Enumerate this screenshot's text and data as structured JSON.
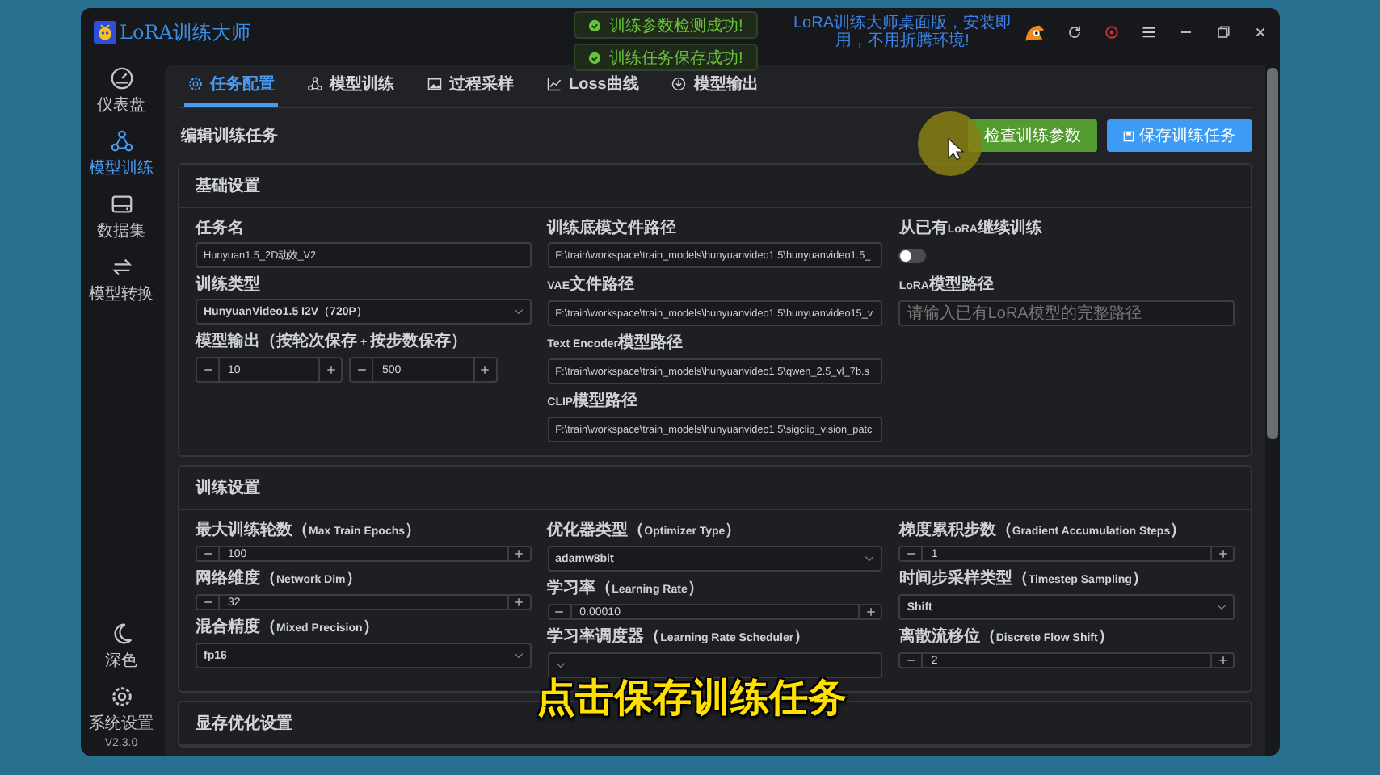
{
  "window": {
    "app_name": "LoRA训练大师",
    "promo": [
      "LoRA训练大师桌面版，安装即",
      "用，不用折腾环境!"
    ]
  },
  "toasts": [
    {
      "text": "训练参数检测成功!"
    },
    {
      "text": "训练任务保存成功!"
    }
  ],
  "sidebar": {
    "items": [
      {
        "label": "仪表盘",
        "selected": false
      },
      {
        "label": "模型训练",
        "selected": true
      },
      {
        "label": "数据集",
        "selected": false
      },
      {
        "label": "模型转换",
        "selected": false
      }
    ],
    "bottom": [
      {
        "label": "深色"
      },
      {
        "label": "系统设置"
      }
    ],
    "version": "V2.3.0"
  },
  "tabs": [
    {
      "label": "任务配置",
      "selected": true
    },
    {
      "label": "模型训练",
      "selected": false
    },
    {
      "label": "过程采样",
      "selected": false
    },
    {
      "label": "Loss曲线",
      "selected": false
    },
    {
      "label": "模型输出",
      "selected": false
    }
  ],
  "page_title": "编辑训练任务",
  "buttons": [
    {
      "label": "检查训练参数",
      "kind": "check"
    },
    {
      "label": "保存训练任务",
      "kind": "save"
    }
  ],
  "sections": [
    {
      "title": "基础设置",
      "columns": [
        [
          {
            "kind": "text",
            "label": "任务名",
            "value": "Hunyuan1.5_2D动效_V2"
          },
          {
            "kind": "select",
            "label": "训练类型",
            "value": "HunyuanVideo1.5 I2V（720P）"
          },
          {
            "kind": "stepper_pair",
            "label": "模型输出（按轮次保存 + 按步数保存）",
            "values": [
              "10",
              "500"
            ]
          }
        ],
        [
          {
            "kind": "text",
            "label": "训练底模文件路径",
            "value": "F:\\train\\workspace\\train_models\\hunyuanvideo1.5\\hunyuanvideo1.5_"
          },
          {
            "kind": "text",
            "label": "VAE文件路径",
            "value": "F:\\train\\workspace\\train_models\\hunyuanvideo1.5\\hunyuanvideo15_v"
          },
          {
            "kind": "text",
            "label": "Text Encoder模型路径",
            "value": "F:\\train\\workspace\\train_models\\hunyuanvideo1.5\\qwen_2.5_vl_7b.s"
          },
          {
            "kind": "text",
            "label": "CLIP模型路径",
            "value": "F:\\train\\workspace\\train_models\\hunyuanvideo1.5\\sigclip_vision_patc"
          }
        ],
        [
          {
            "kind": "toggle",
            "label": "从已有LoRA继续训练",
            "on": false
          },
          {
            "kind": "text",
            "label": "LoRA模型路径",
            "placeholder": "请输入已有LoRA模型的完整路径"
          }
        ]
      ]
    },
    {
      "title": "训练设置",
      "columns": [
        [
          {
            "kind": "stepper",
            "label": "最大训练轮数（Max Train Epochs）",
            "value": "100"
          },
          {
            "kind": "stepper",
            "label": "网络维度（Network Dim）",
            "value": "32"
          },
          {
            "kind": "select",
            "label": "混合精度（Mixed Precision）",
            "value": "fp16"
          }
        ],
        [
          {
            "kind": "select",
            "label": "优化器类型（Optimizer Type）",
            "value": "adamw8bit"
          },
          {
            "kind": "stepper",
            "label": "学习率（Learning Rate）",
            "value": "0.00010"
          },
          {
            "kind": "select",
            "label": "学习率调度器（Learning Rate Scheduler）"
          }
        ],
        [
          {
            "kind": "stepper",
            "label": "梯度累积步数（Gradient Accumulation Steps）",
            "value": "1"
          },
          {
            "kind": "select",
            "label": "时间步采样类型（Timestep Sampling）",
            "value": "Shift"
          },
          {
            "kind": "stepper",
            "label": "离散流移位（Discrete Flow Shift）",
            "value": "2"
          }
        ]
      ]
    },
    {
      "title": "显存优化设置"
    }
  ],
  "caption": "点击保存训练任务"
}
